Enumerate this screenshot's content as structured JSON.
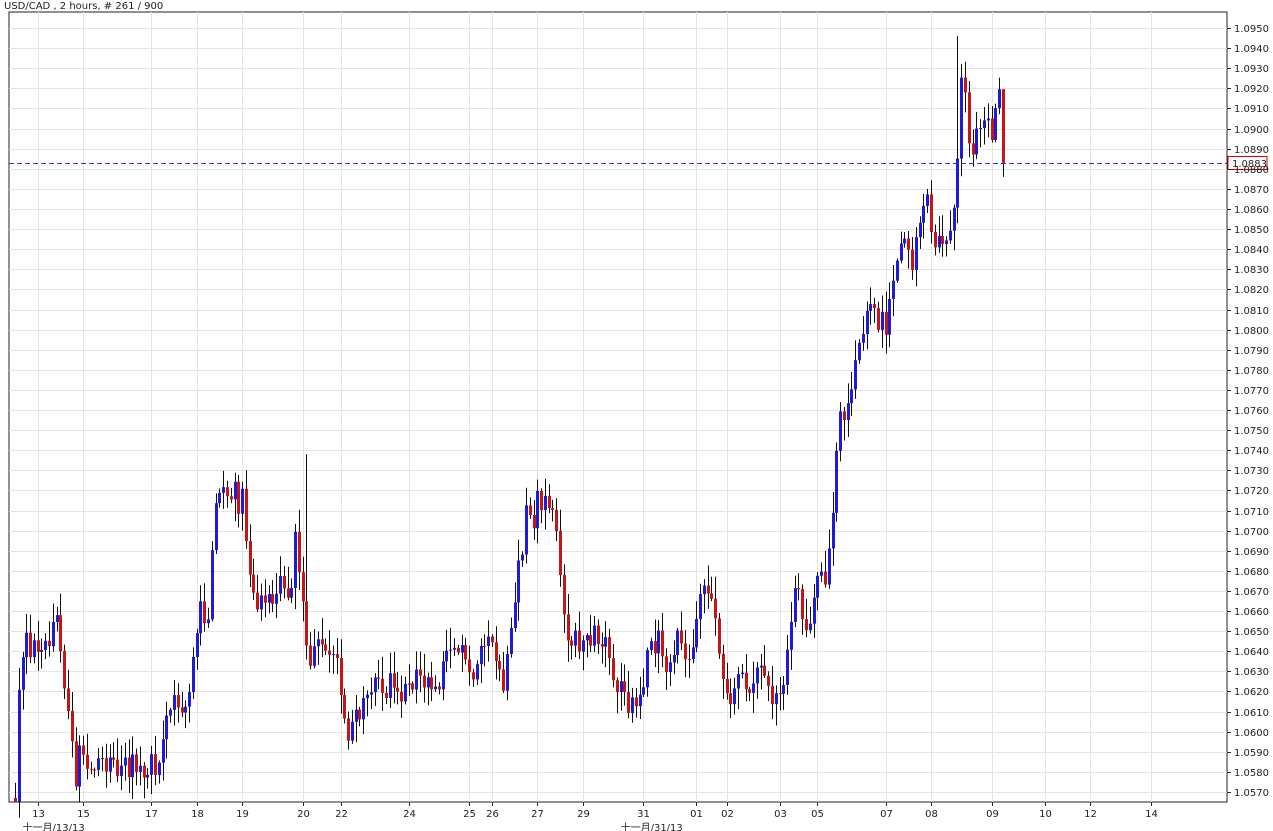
{
  "header": {
    "title": "USD/CAD , 2 hours, # 261 / 900"
  },
  "colors": {
    "up": "#1b1bd8",
    "down": "#c81414",
    "grid": "#e4e4e4",
    "price_line": "#2a2ad0",
    "price_box": "#cc0000"
  },
  "chart_data": {
    "type": "candlestick",
    "symbol": "USD/CAD",
    "timeframe": "2 hours",
    "ylim": [
      1.0565,
      1.0958
    ],
    "y_ticks": [
      "1.0950",
      "1.0940",
      "1.0930",
      "1.0920",
      "1.0910",
      "1.0900",
      "1.0890",
      "1.0880",
      "1.0870",
      "1.0860",
      "1.0850",
      "1.0840",
      "1.0830",
      "1.0820",
      "1.0810",
      "1.0800",
      "1.0790",
      "1.0780",
      "1.0770",
      "1.0760",
      "1.0750",
      "1.0740",
      "1.0730",
      "1.0720",
      "1.0710",
      "1.0700",
      "1.0690",
      "1.0680",
      "1.0670",
      "1.0660",
      "1.0650",
      "1.0640",
      "1.0630",
      "1.0620",
      "1.0610",
      "1.0600",
      "1.0590",
      "1.0580",
      "1.0570"
    ],
    "x_tick_labels": [
      {
        "label": "13",
        "index": 6
      },
      {
        "label": "15",
        "index": 18
      },
      {
        "label": "17",
        "index": 36
      },
      {
        "label": "18",
        "index": 48
      },
      {
        "label": "19",
        "index": 60
      },
      {
        "label": "20",
        "index": 76
      },
      {
        "label": "22",
        "index": 86
      },
      {
        "label": "24",
        "index": 104
      },
      {
        "label": "25",
        "index": 120
      },
      {
        "label": "26",
        "index": 126
      },
      {
        "label": "27",
        "index": 138
      },
      {
        "label": "29",
        "index": 150
      },
      {
        "label": "31",
        "index": 166
      },
      {
        "label": "01",
        "index": 180
      },
      {
        "label": "02",
        "index": 188
      },
      {
        "label": "03",
        "index": 202
      },
      {
        "label": "05",
        "index": 212
      },
      {
        "label": "07",
        "index": 230
      },
      {
        "label": "08",
        "index": 242
      },
      {
        "label": "09",
        "index": 258
      },
      {
        "label": "10",
        "index": 272
      },
      {
        "label": "12",
        "index": 284
      },
      {
        "label": "14",
        "index": 300
      }
    ],
    "bottom_labels": [
      {
        "label": "十一月/13/13",
        "index": 2
      },
      {
        "label": "十一月/31/13",
        "index": 160
      }
    ],
    "current_price": "1.0883",
    "anchors": [
      [
        0,
        1.0565
      ],
      [
        1,
        1.062
      ],
      [
        2,
        1.0636
      ],
      [
        3,
        1.0648
      ],
      [
        4,
        1.0638
      ],
      [
        5,
        1.0645
      ],
      [
        6,
        1.0638
      ],
      [
        7,
        1.0643
      ],
      [
        8,
        1.0646
      ],
      [
        9,
        1.064
      ],
      [
        10,
        1.0655
      ],
      [
        11,
        1.066
      ],
      [
        12,
        1.064
      ],
      [
        13,
        1.062
      ],
      [
        14,
        1.0608
      ],
      [
        15,
        1.0595
      ],
      [
        16,
        1.0575
      ],
      [
        17,
        1.0592
      ],
      [
        18,
        1.059
      ],
      [
        19,
        1.0582
      ],
      [
        20,
        1.0584
      ],
      [
        21,
        1.058
      ],
      [
        22,
        1.0588
      ],
      [
        23,
        1.0585
      ],
      [
        24,
        1.0578
      ],
      [
        25,
        1.059
      ],
      [
        26,
        1.0586
      ],
      [
        27,
        1.0578
      ],
      [
        28,
        1.0583
      ],
      [
        29,
        1.059
      ],
      [
        30,
        1.0578
      ],
      [
        31,
        1.059
      ],
      [
        32,
        1.058
      ],
      [
        33,
        1.0582
      ],
      [
        34,
        1.0576
      ],
      [
        35,
        1.0581
      ],
      [
        36,
        1.0587
      ],
      [
        37,
        1.058
      ],
      [
        38,
        1.0585
      ],
      [
        39,
        1.0595
      ],
      [
        40,
        1.0605
      ],
      [
        41,
        1.0612
      ],
      [
        42,
        1.0618
      ],
      [
        43,
        1.0611
      ],
      [
        44,
        1.0607
      ],
      [
        45,
        1.0612
      ],
      [
        46,
        1.062
      ],
      [
        47,
        1.0638
      ],
      [
        48,
        1.065
      ],
      [
        49,
        1.0662
      ],
      [
        50,
        1.0652
      ],
      [
        51,
        1.0656
      ],
      [
        52,
        1.0688
      ],
      [
        53,
        1.0713
      ],
      [
        54,
        1.0721
      ],
      [
        55,
        1.072
      ],
      [
        56,
        1.0718
      ],
      [
        57,
        1.0713
      ],
      [
        58,
        1.0722
      ],
      [
        59,
        1.071
      ],
      [
        60,
        1.0718
      ],
      [
        61,
        1.0696
      ],
      [
        62,
        1.0678
      ],
      [
        63,
        1.0668
      ],
      [
        64,
        1.0663
      ],
      [
        65,
        1.067
      ],
      [
        66,
        1.0665
      ],
      [
        67,
        1.0668
      ],
      [
        68,
        1.0664
      ],
      [
        69,
        1.0666
      ],
      [
        70,
        1.0678
      ],
      [
        71,
        1.0674
      ],
      [
        72,
        1.0664
      ],
      [
        73,
        1.0672
      ],
      [
        74,
        1.0697
      ],
      [
        75,
        1.0678
      ],
      [
        76,
        1.0665
      ],
      [
        77,
        1.0644
      ],
      [
        78,
        1.0632
      ],
      [
        79,
        1.064
      ],
      [
        80,
        1.0645
      ],
      [
        81,
        1.0642
      ],
      [
        82,
        1.0638
      ],
      [
        83,
        1.064
      ],
      [
        84,
        1.064
      ],
      [
        85,
        1.0635
      ],
      [
        86,
        1.062
      ],
      [
        87,
        1.0605
      ],
      [
        88,
        1.0598
      ],
      [
        89,
        1.0605
      ],
      [
        90,
        1.0612
      ],
      [
        91,
        1.0608
      ],
      [
        92,
        1.0615
      ],
      [
        93,
        1.0618
      ],
      [
        94,
        1.062
      ],
      [
        95,
        1.0628
      ],
      [
        96,
        1.0626
      ],
      [
        97,
        1.0622
      ],
      [
        98,
        1.0615
      ],
      [
        99,
        1.0628
      ],
      [
        100,
        1.0622
      ],
      [
        101,
        1.062
      ],
      [
        102,
        1.0615
      ],
      [
        103,
        1.0625
      ],
      [
        104,
        1.0626
      ],
      [
        105,
        1.0622
      ],
      [
        106,
        1.0628
      ],
      [
        107,
        1.0625
      ],
      [
        108,
        1.062
      ],
      [
        109,
        1.0626
      ],
      [
        110,
        1.0622
      ],
      [
        111,
        1.062
      ],
      [
        112,
        1.062
      ],
      [
        113,
        1.0632
      ],
      [
        114,
        1.0643
      ],
      [
        115,
        1.064
      ],
      [
        116,
        1.064
      ],
      [
        117,
        1.0638
      ],
      [
        118,
        1.0641
      ],
      [
        119,
        1.0635
      ],
      [
        120,
        1.0632
      ],
      [
        121,
        1.0625
      ],
      [
        122,
        1.0635
      ],
      [
        123,
        1.0645
      ],
      [
        124,
        1.0645
      ],
      [
        125,
        1.065
      ],
      [
        126,
        1.0645
      ],
      [
        127,
        1.0637
      ],
      [
        128,
        1.063
      ],
      [
        129,
        1.0622
      ],
      [
        130,
        1.064
      ],
      [
        131,
        1.0652
      ],
      [
        132,
        1.0667
      ],
      [
        133,
        1.0685
      ],
      [
        134,
        1.069
      ],
      [
        135,
        1.071
      ],
      [
        136,
        1.0705
      ],
      [
        137,
        1.0702
      ],
      [
        138,
        1.072
      ],
      [
        139,
        1.071
      ],
      [
        140,
        1.0715
      ],
      [
        141,
        1.0712
      ],
      [
        142,
        1.071
      ],
      [
        143,
        1.0698
      ],
      [
        144,
        1.0676
      ],
      [
        145,
        1.0659
      ],
      [
        146,
        1.0645
      ],
      [
        147,
        1.064
      ],
      [
        148,
        1.0649
      ],
      [
        149,
        1.0642
      ],
      [
        150,
        1.0648
      ],
      [
        151,
        1.065
      ],
      [
        152,
        1.0644
      ],
      [
        153,
        1.065
      ],
      [
        154,
        1.0644
      ],
      [
        155,
        1.0641
      ],
      [
        156,
        1.0646
      ],
      [
        157,
        1.0635
      ],
      [
        158,
        1.0628
      ],
      [
        159,
        1.062
      ],
      [
        160,
        1.0625
      ],
      [
        161,
        1.062
      ],
      [
        162,
        1.0612
      ],
      [
        163,
        1.062
      ],
      [
        164,
        1.0615
      ],
      [
        165,
        1.0618
      ],
      [
        166,
        1.0625
      ],
      [
        167,
        1.064
      ],
      [
        168,
        1.0646
      ],
      [
        169,
        1.064
      ],
      [
        170,
        1.0648
      ],
      [
        171,
        1.064
      ],
      [
        172,
        1.063
      ],
      [
        173,
        1.0632
      ],
      [
        174,
        1.064
      ],
      [
        175,
        1.065
      ],
      [
        176,
        1.0645
      ],
      [
        177,
        1.0638
      ],
      [
        178,
        1.0634
      ],
      [
        179,
        1.0644
      ],
      [
        180,
        1.0655
      ],
      [
        181,
        1.0668
      ],
      [
        182,
        1.0672
      ],
      [
        183,
        1.067
      ],
      [
        184,
        1.0664
      ],
      [
        185,
        1.0654
      ],
      [
        186,
        1.064
      ],
      [
        187,
        1.0628
      ],
      [
        188,
        1.062
      ],
      [
        189,
        1.0615
      ],
      [
        190,
        1.0622
      ],
      [
        191,
        1.063
      ],
      [
        192,
        1.0628
      ],
      [
        193,
        1.062
      ],
      [
        194,
        1.0618
      ],
      [
        195,
        1.0624
      ],
      [
        196,
        1.063
      ],
      [
        197,
        1.0633
      ],
      [
        198,
        1.0625
      ],
      [
        199,
        1.062
      ],
      [
        200,
        1.0612
      ],
      [
        201,
        1.062
      ],
      [
        202,
        1.0618
      ],
      [
        203,
        1.0625
      ],
      [
        204,
        1.0638
      ],
      [
        205,
        1.0655
      ],
      [
        206,
        1.067
      ],
      [
        207,
        1.0668
      ],
      [
        208,
        1.0656
      ],
      [
        209,
        1.0648
      ],
      [
        210,
        1.0652
      ],
      [
        211,
        1.0668
      ],
      [
        212,
        1.0678
      ],
      [
        213,
        1.068
      ],
      [
        214,
        1.0673
      ],
      [
        215,
        1.069
      ],
      [
        216,
        1.0708
      ],
      [
        217,
        1.0738
      ],
      [
        218,
        1.076
      ],
      [
        219,
        1.0753
      ],
      [
        220,
        1.0765
      ],
      [
        221,
        1.077
      ],
      [
        222,
        1.0782
      ],
      [
        223,
        1.0795
      ],
      [
        224,
        1.08
      ],
      [
        225,
        1.0808
      ],
      [
        226,
        1.0814
      ],
      [
        227,
        1.0808
      ],
      [
        228,
        1.08
      ],
      [
        229,
        1.0806
      ],
      [
        230,
        1.0798
      ],
      [
        231,
        1.0813
      ],
      [
        232,
        1.0822
      ],
      [
        233,
        1.0832
      ],
      [
        234,
        1.0843
      ],
      [
        235,
        1.0845
      ],
      [
        236,
        1.0838
      ],
      [
        237,
        1.0832
      ],
      [
        238,
        1.0848
      ],
      [
        239,
        1.0856
      ],
      [
        240,
        1.0863
      ],
      [
        241,
        1.0867
      ],
      [
        242,
        1.0848
      ],
      [
        243,
        1.0842
      ],
      [
        244,
        1.0846
      ],
      [
        245,
        1.0842
      ],
      [
        246,
        1.0844
      ],
      [
        247,
        1.0852
      ],
      [
        248,
        1.0862
      ],
      [
        249,
        1.0888
      ],
      [
        250,
        1.0928
      ],
      [
        251,
        1.092
      ],
      [
        252,
        1.0895
      ],
      [
        253,
        1.089
      ],
      [
        254,
        1.0898
      ],
      [
        255,
        1.0903
      ],
      [
        256,
        1.0906
      ],
      [
        257,
        1.0904
      ],
      [
        258,
        1.0892
      ],
      [
        259,
        1.091
      ],
      [
        260,
        1.0922
      ],
      [
        261,
        1.0883
      ]
    ]
  }
}
